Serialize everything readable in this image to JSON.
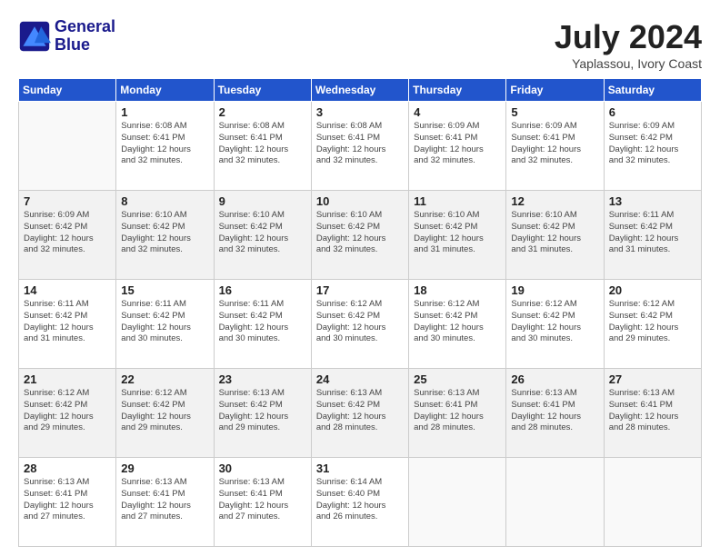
{
  "header": {
    "logo_line1": "General",
    "logo_line2": "Blue",
    "month_title": "July 2024",
    "location": "Yaplassou, Ivory Coast"
  },
  "days_of_week": [
    "Sunday",
    "Monday",
    "Tuesday",
    "Wednesday",
    "Thursday",
    "Friday",
    "Saturday"
  ],
  "weeks": [
    [
      {
        "day": "",
        "info": ""
      },
      {
        "day": "1",
        "info": "Sunrise: 6:08 AM\nSunset: 6:41 PM\nDaylight: 12 hours\nand 32 minutes."
      },
      {
        "day": "2",
        "info": "Sunrise: 6:08 AM\nSunset: 6:41 PM\nDaylight: 12 hours\nand 32 minutes."
      },
      {
        "day": "3",
        "info": "Sunrise: 6:08 AM\nSunset: 6:41 PM\nDaylight: 12 hours\nand 32 minutes."
      },
      {
        "day": "4",
        "info": "Sunrise: 6:09 AM\nSunset: 6:41 PM\nDaylight: 12 hours\nand 32 minutes."
      },
      {
        "day": "5",
        "info": "Sunrise: 6:09 AM\nSunset: 6:41 PM\nDaylight: 12 hours\nand 32 minutes."
      },
      {
        "day": "6",
        "info": "Sunrise: 6:09 AM\nSunset: 6:42 PM\nDaylight: 12 hours\nand 32 minutes."
      }
    ],
    [
      {
        "day": "7",
        "info": "Sunrise: 6:09 AM\nSunset: 6:42 PM\nDaylight: 12 hours\nand 32 minutes."
      },
      {
        "day": "8",
        "info": "Sunrise: 6:10 AM\nSunset: 6:42 PM\nDaylight: 12 hours\nand 32 minutes."
      },
      {
        "day": "9",
        "info": "Sunrise: 6:10 AM\nSunset: 6:42 PM\nDaylight: 12 hours\nand 32 minutes."
      },
      {
        "day": "10",
        "info": "Sunrise: 6:10 AM\nSunset: 6:42 PM\nDaylight: 12 hours\nand 32 minutes."
      },
      {
        "day": "11",
        "info": "Sunrise: 6:10 AM\nSunset: 6:42 PM\nDaylight: 12 hours\nand 31 minutes."
      },
      {
        "day": "12",
        "info": "Sunrise: 6:10 AM\nSunset: 6:42 PM\nDaylight: 12 hours\nand 31 minutes."
      },
      {
        "day": "13",
        "info": "Sunrise: 6:11 AM\nSunset: 6:42 PM\nDaylight: 12 hours\nand 31 minutes."
      }
    ],
    [
      {
        "day": "14",
        "info": "Sunrise: 6:11 AM\nSunset: 6:42 PM\nDaylight: 12 hours\nand 31 minutes."
      },
      {
        "day": "15",
        "info": "Sunrise: 6:11 AM\nSunset: 6:42 PM\nDaylight: 12 hours\nand 30 minutes."
      },
      {
        "day": "16",
        "info": "Sunrise: 6:11 AM\nSunset: 6:42 PM\nDaylight: 12 hours\nand 30 minutes."
      },
      {
        "day": "17",
        "info": "Sunrise: 6:12 AM\nSunset: 6:42 PM\nDaylight: 12 hours\nand 30 minutes."
      },
      {
        "day": "18",
        "info": "Sunrise: 6:12 AM\nSunset: 6:42 PM\nDaylight: 12 hours\nand 30 minutes."
      },
      {
        "day": "19",
        "info": "Sunrise: 6:12 AM\nSunset: 6:42 PM\nDaylight: 12 hours\nand 30 minutes."
      },
      {
        "day": "20",
        "info": "Sunrise: 6:12 AM\nSunset: 6:42 PM\nDaylight: 12 hours\nand 29 minutes."
      }
    ],
    [
      {
        "day": "21",
        "info": "Sunrise: 6:12 AM\nSunset: 6:42 PM\nDaylight: 12 hours\nand 29 minutes."
      },
      {
        "day": "22",
        "info": "Sunrise: 6:12 AM\nSunset: 6:42 PM\nDaylight: 12 hours\nand 29 minutes."
      },
      {
        "day": "23",
        "info": "Sunrise: 6:13 AM\nSunset: 6:42 PM\nDaylight: 12 hours\nand 29 minutes."
      },
      {
        "day": "24",
        "info": "Sunrise: 6:13 AM\nSunset: 6:42 PM\nDaylight: 12 hours\nand 28 minutes."
      },
      {
        "day": "25",
        "info": "Sunrise: 6:13 AM\nSunset: 6:41 PM\nDaylight: 12 hours\nand 28 minutes."
      },
      {
        "day": "26",
        "info": "Sunrise: 6:13 AM\nSunset: 6:41 PM\nDaylight: 12 hours\nand 28 minutes."
      },
      {
        "day": "27",
        "info": "Sunrise: 6:13 AM\nSunset: 6:41 PM\nDaylight: 12 hours\nand 28 minutes."
      }
    ],
    [
      {
        "day": "28",
        "info": "Sunrise: 6:13 AM\nSunset: 6:41 PM\nDaylight: 12 hours\nand 27 minutes."
      },
      {
        "day": "29",
        "info": "Sunrise: 6:13 AM\nSunset: 6:41 PM\nDaylight: 12 hours\nand 27 minutes."
      },
      {
        "day": "30",
        "info": "Sunrise: 6:13 AM\nSunset: 6:41 PM\nDaylight: 12 hours\nand 27 minutes."
      },
      {
        "day": "31",
        "info": "Sunrise: 6:14 AM\nSunset: 6:40 PM\nDaylight: 12 hours\nand 26 minutes."
      },
      {
        "day": "",
        "info": ""
      },
      {
        "day": "",
        "info": ""
      },
      {
        "day": "",
        "info": ""
      }
    ]
  ]
}
